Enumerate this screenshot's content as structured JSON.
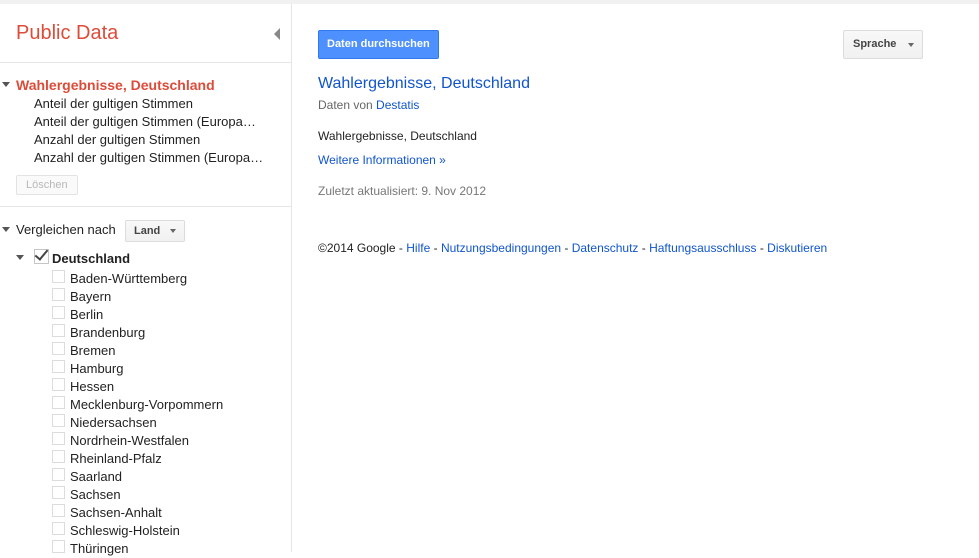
{
  "header": {
    "logo": "Public Data"
  },
  "sidebar": {
    "dataset_title": "Wahlergebnisse, Deutschland",
    "metrics": [
      "Anteil der gultigen Stimmen",
      "Anteil der gultigen Stimmen (Europawahl)",
      "Anzahl der gultigen Stimmen",
      "Anzahl der gultigen Stimmen (Europawahl)"
    ],
    "clear_label": "Löschen",
    "compare_label": "Vergleichen nach",
    "compare_dropdown": "Land",
    "country": {
      "label": "Deutschland",
      "checked": true
    },
    "states": [
      "Baden-Württemberg",
      "Bayern",
      "Berlin",
      "Brandenburg",
      "Bremen",
      "Hamburg",
      "Hessen",
      "Mecklenburg-Vorpommern",
      "Niedersachsen",
      "Nordrhein-Westfalen",
      "Rheinland-Pfalz",
      "Saarland",
      "Sachsen",
      "Sachsen-Anhalt",
      "Schleswig-Holstein",
      "Thüringen"
    ]
  },
  "main": {
    "explore_button": "Daten durchsuchen",
    "language_button": "Sprache",
    "title": "Wahlergebnisse, Deutschland",
    "by_prefix": "Daten von",
    "by_source": "Destatis",
    "description": "Wahlergebnisse, Deutschland",
    "more_info": "Weitere Informationen »",
    "updated": "Zuletzt aktualisiert: 9. Nov 2012"
  },
  "footer": {
    "copyright": "©2014 Google",
    "links": [
      "Hilfe",
      "Nutzungsbedingungen",
      "Datenschutz",
      "Haftungsausschluss",
      "Diskutieren"
    ],
    "separator": " - "
  },
  "colors": {
    "brand": "#dd4b39",
    "link": "#1155cc",
    "primary_button": "#4d90fe"
  }
}
